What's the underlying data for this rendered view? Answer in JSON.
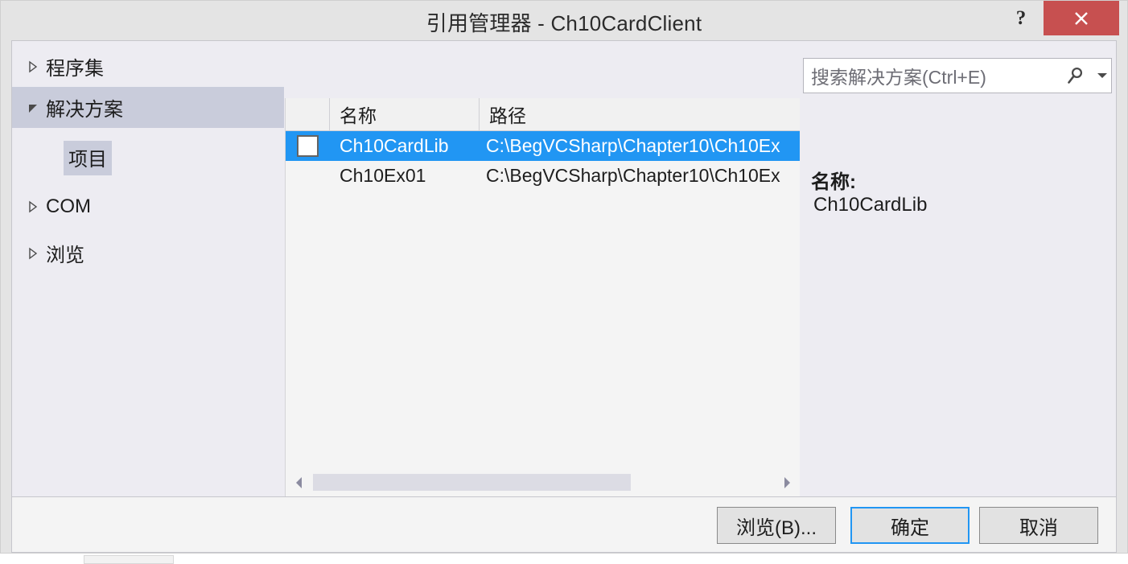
{
  "window": {
    "title": "引用管理器 - Ch10CardClient",
    "help_label": "?",
    "close_label": "close-icon",
    "accent_blue": "#2196f3",
    "close_red": "#c75050",
    "dialog_bg": "#e4e4e4",
    "pane_bg": "#edecf2",
    "list_bg": "#f4f4f4",
    "selected_row_bg": "#c9ccdb"
  },
  "tree": {
    "items": [
      {
        "label": "程序集",
        "expander": "collapsed",
        "level": 0,
        "selected": false
      },
      {
        "label": "解决方案",
        "expander": "expanded",
        "level": 0,
        "selected": true
      },
      {
        "label": "项目",
        "expander": "none",
        "level": 1,
        "selected": false
      },
      {
        "label": "COM",
        "expander": "collapsed",
        "level": 0,
        "selected": false
      },
      {
        "label": "浏览",
        "expander": "collapsed",
        "level": 0,
        "selected": false
      }
    ]
  },
  "list": {
    "columns": [
      {
        "key": "check",
        "label": ""
      },
      {
        "key": "name",
        "label": "名称"
      },
      {
        "key": "path",
        "label": "路径"
      }
    ],
    "rows": [
      {
        "checked": false,
        "name": "Ch10CardLib",
        "path": "C:\\BegVCSharp\\Chapter10\\Ch10Ex",
        "selected": true,
        "show_checkbox": true
      },
      {
        "checked": false,
        "name": "Ch10Ex01",
        "path": "C:\\BegVCSharp\\Chapter10\\Ch10Ex",
        "selected": false,
        "show_checkbox": false
      }
    ],
    "hscroll": {
      "left_arrow": "scroll-left-icon",
      "right_arrow": "scroll-right-icon",
      "thumb_percent": 69
    }
  },
  "search": {
    "value": "",
    "placeholder": "搜索解决方案(Ctrl+E)",
    "icon": "search-icon",
    "dropdown_icon": "chevron-down-icon"
  },
  "detail": {
    "name_label": "名称:",
    "name_value": "Ch10CardLib"
  },
  "footer": {
    "browse_label": "浏览(B)...",
    "ok_label": "确定",
    "cancel_label": "取消"
  }
}
